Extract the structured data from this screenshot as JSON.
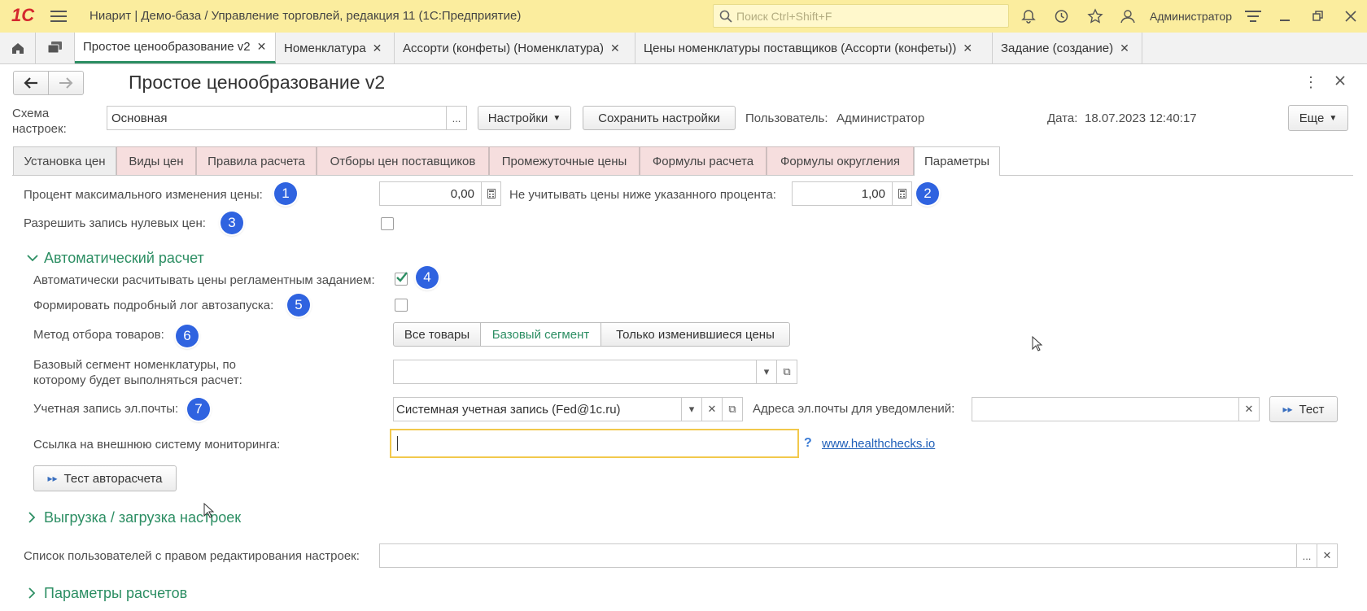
{
  "window": {
    "logo": "1С",
    "title": "Ниарит | Демо-база / Управление торговлей, редакция 11  (1С:Предприятие)",
    "search_placeholder": "Поиск Ctrl+Shift+F",
    "user": "Администратор"
  },
  "open_tabs": [
    {
      "label": "Простое ценообразование v2"
    },
    {
      "label": "Номенклатура"
    },
    {
      "label": "Ассорти (конфеты) (Номенклатура)"
    },
    {
      "label": "Цены номенклатуры поставщиков (Ассорти (конфеты))"
    },
    {
      "label": "Задание (создание)"
    }
  ],
  "form": {
    "title": "Простое ценообразование v2",
    "scheme_label_line1": "Схема",
    "scheme_label_line2": "настроек:",
    "scheme_value": "Основная",
    "settings_button": "Настройки",
    "save_settings_button": "Сохранить настройки",
    "user_label": "Пользователь:",
    "user_value": "Администратор",
    "date_label": "Дата:",
    "date_value": "18.07.2023 12:40:17",
    "more_button": "Еще"
  },
  "form_tabs": [
    {
      "label": "Установка цен"
    },
    {
      "label": "Виды цен"
    },
    {
      "label": "Правила расчета"
    },
    {
      "label": "Отборы цен поставщиков"
    },
    {
      "label": "Промежуточные цены"
    },
    {
      "label": "Формулы расчета"
    },
    {
      "label": "Формулы округления"
    },
    {
      "label": "Параметры"
    }
  ],
  "params": {
    "max_change_label": "Процент максимального изменения цены:",
    "max_change_value": "0,00",
    "ignore_below_label": "Не учитывать цены ниже указанного процента:",
    "ignore_below_value": "1,00",
    "allow_zero_label": "Разрешить запись нулевых цен:",
    "auto_section": "Автоматический расчет",
    "auto_calc_label": "Автоматически расчитывать цены регламентным заданием:",
    "detailed_log_label": "Формировать подробный лог автозапуска:",
    "selection_method_label": "Метод отбора товаров:",
    "selection_options": [
      "Все товары",
      "Базовый сегмент",
      "Только изменившиеся цены"
    ],
    "base_segment_label_line1": "Базовый сегмент номенклатуры, по",
    "base_segment_label_line2": "которому будет выполняться расчет:",
    "email_account_label": "Учетная запись эл.почты:",
    "email_account_value": "Системная учетная запись (Fed@1c.ru)",
    "notify_label": "Адреса эл.почты для уведомлений:",
    "test_button": "Тест",
    "monitoring_label": "Ссылка на внешнюю систему мониторинга:",
    "help_mark": "?",
    "monitoring_link": "www.healthchecks.io",
    "test_auto_button": "Тест авторасчета",
    "export_section": "Выгрузка / загрузка настроек",
    "editors_label": "Список пользователей с правом редактирования настроек:",
    "calc_params_section": "Параметры расчетов"
  },
  "badges": [
    "1",
    "2",
    "3",
    "4",
    "5",
    "6",
    "7"
  ],
  "colors": {
    "titlebar": "#fbed9e",
    "accent_green": "#2c8e63",
    "badge_blue": "#2f63e0",
    "tab_pink": "#f6dede",
    "focus_yellow": "#f2c94c"
  }
}
